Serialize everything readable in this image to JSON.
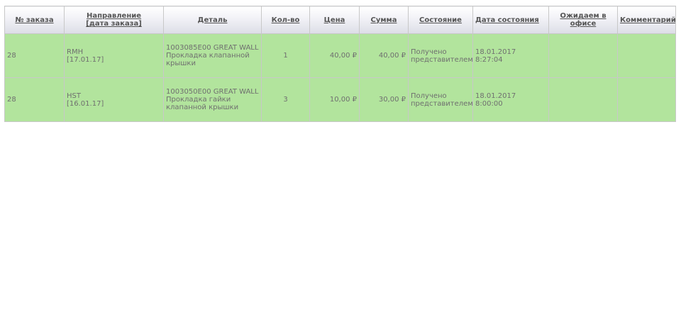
{
  "headers": {
    "order_no": "№ заказа",
    "direction": "Направление",
    "direction_sub": "[дата заказа]",
    "part": "Деталь",
    "qty": "Кол-во",
    "price": "Цена",
    "sum": "Сумма",
    "status": "Состояние",
    "status_date": "Дата состояния",
    "awaiting": "Ожидаем в офисе",
    "comment": "Комментарий"
  },
  "rows": [
    {
      "order_no": "28",
      "direction": "RMH",
      "order_date": "[17.01.17]",
      "part_code": "1003085E00 GREAT WALL",
      "part_name": "Прокладка клапанной крышки",
      "qty": "1",
      "price": "40,00 ₽",
      "sum": "40,00 ₽",
      "status": "Получено представителем",
      "status_date": "18.01.2017",
      "status_time": "8:27:04",
      "awaiting": "",
      "comment": ""
    },
    {
      "order_no": "28",
      "direction": "HST",
      "order_date": "[16.01.17]",
      "part_code": "1003050E00 GREAT WALL",
      "part_name": "Прокладка гайки клапанной крышки",
      "qty": "3",
      "price": "10,00 ₽",
      "sum": "30,00 ₽",
      "status": "Получено представителем",
      "status_date": "18.01.2017",
      "status_time": "8:00:00",
      "awaiting": "",
      "comment": ""
    }
  ],
  "colors": {
    "row_background": "#b2e49d",
    "header_text": "#555555",
    "cell_text": "#6f6f6f",
    "border": "#c8c8c8"
  }
}
